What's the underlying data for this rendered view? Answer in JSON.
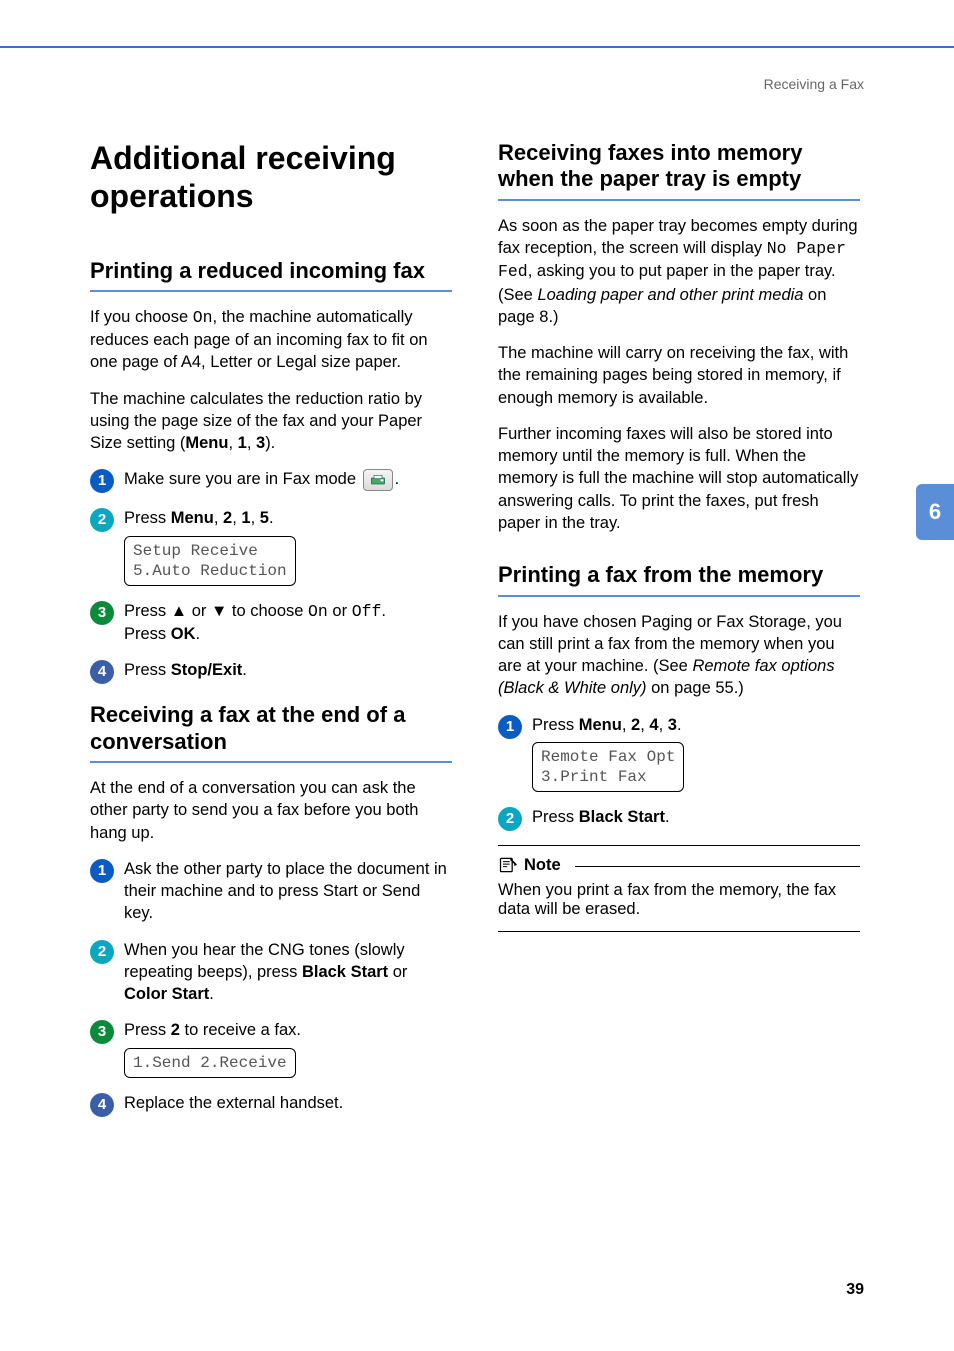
{
  "running_head": "Receiving a Fax",
  "chapter_tab": "6",
  "page_number": "39",
  "left": {
    "h1": "Additional receiving operations",
    "sec1": {
      "h2": "Printing a reduced incoming fax",
      "p1_a": "If you choose ",
      "p1_on": "On",
      "p1_b": ", the machine automatically reduces each page of an incoming fax to fit on one page of A4, Letter or Legal size paper.",
      "p2_a": "The machine calculates the reduction ratio by using the page size of the fax and your Paper Size setting (",
      "p2_menu": "Menu",
      "p2_b": ", ",
      "p2_1": "1",
      "p2_c": ", ",
      "p2_3": "3",
      "p2_d": ").",
      "step1": "Make sure you are in Fax mode ",
      "step1_end": ".",
      "step2_a": "Press ",
      "step2_menu": "Menu",
      "step2_b": ", ",
      "step2_2": "2",
      "step2_c": ", ",
      "step2_1": "1",
      "step2_d": ", ",
      "step2_5": "5",
      "step2_e": ".",
      "lcd2": "Setup Receive\n5.Auto Reduction",
      "step3_a": "Press ",
      "step3_up": "a",
      "step3_or1": " or ",
      "step3_dn": "b",
      "step3_b": " to choose ",
      "step3_on": "On",
      "step3_or2": " or ",
      "step3_off": "Off",
      "step3_c": ".",
      "step3_d": "Press ",
      "step3_ok": "OK",
      "step3_e": ".",
      "step4_a": "Press ",
      "step4_btn": "Stop/Exit",
      "step4_b": "."
    },
    "sec2": {
      "h2": "Receiving a fax at the end of a conversation",
      "p1": "At the end of a conversation you can ask the other party to send you a fax before you both hang up.",
      "step1": "Ask the other party to place the document in their machine and to press Start or Send key.",
      "step2_a": "When you hear the CNG tones (slowly repeating beeps), press ",
      "step2_bs": "Black Start",
      "step2_or": " or ",
      "step2_cs": "Color Start",
      "step2_b": ".",
      "step3_a": "Press ",
      "step3_2": "2",
      "step3_b": " to receive a fax.",
      "lcd3": "1.Send 2.Receive",
      "step4": "Replace the external handset."
    }
  },
  "right": {
    "sec1": {
      "h2": "Receiving faxes into memory when the paper tray is empty",
      "p1_a": "As soon as the paper tray becomes empty during fax reception, the screen will display ",
      "p1_mono": "No Paper Fed",
      "p1_b": ", asking you to put paper in the paper tray. (See ",
      "p1_link": "Loading paper and other print media",
      "p1_c": " on page 8.)",
      "p2": "The machine will carry on receiving the fax, with the remaining pages being stored in memory, if enough memory is available.",
      "p3": "Further incoming faxes will also be stored into memory until the memory is full. When the memory is full the machine will stop automatically answering calls. To print the faxes, put fresh paper in the tray."
    },
    "sec2": {
      "h2": "Printing a fax from the memory",
      "p1_a": "If you have chosen Paging or Fax Storage, you can still print a fax from the memory when you are at your machine. (See ",
      "p1_link": "Remote fax options (Black & White only)",
      "p1_b": " on page 55.)",
      "step1_a": "Press ",
      "step1_menu": "Menu",
      "step1_b": ", ",
      "step1_2": "2",
      "step1_c": ", ",
      "step1_4": "4",
      "step1_d": ", ",
      "step1_3": "3",
      "step1_e": ".",
      "lcd1": "Remote Fax Opt\n3.Print Fax",
      "step2_a": "Press ",
      "step2_btn": "Black Start",
      "step2_b": ".",
      "note_title": "Note",
      "note_body": "When you print a fax from the memory, the fax data will be erased."
    }
  }
}
